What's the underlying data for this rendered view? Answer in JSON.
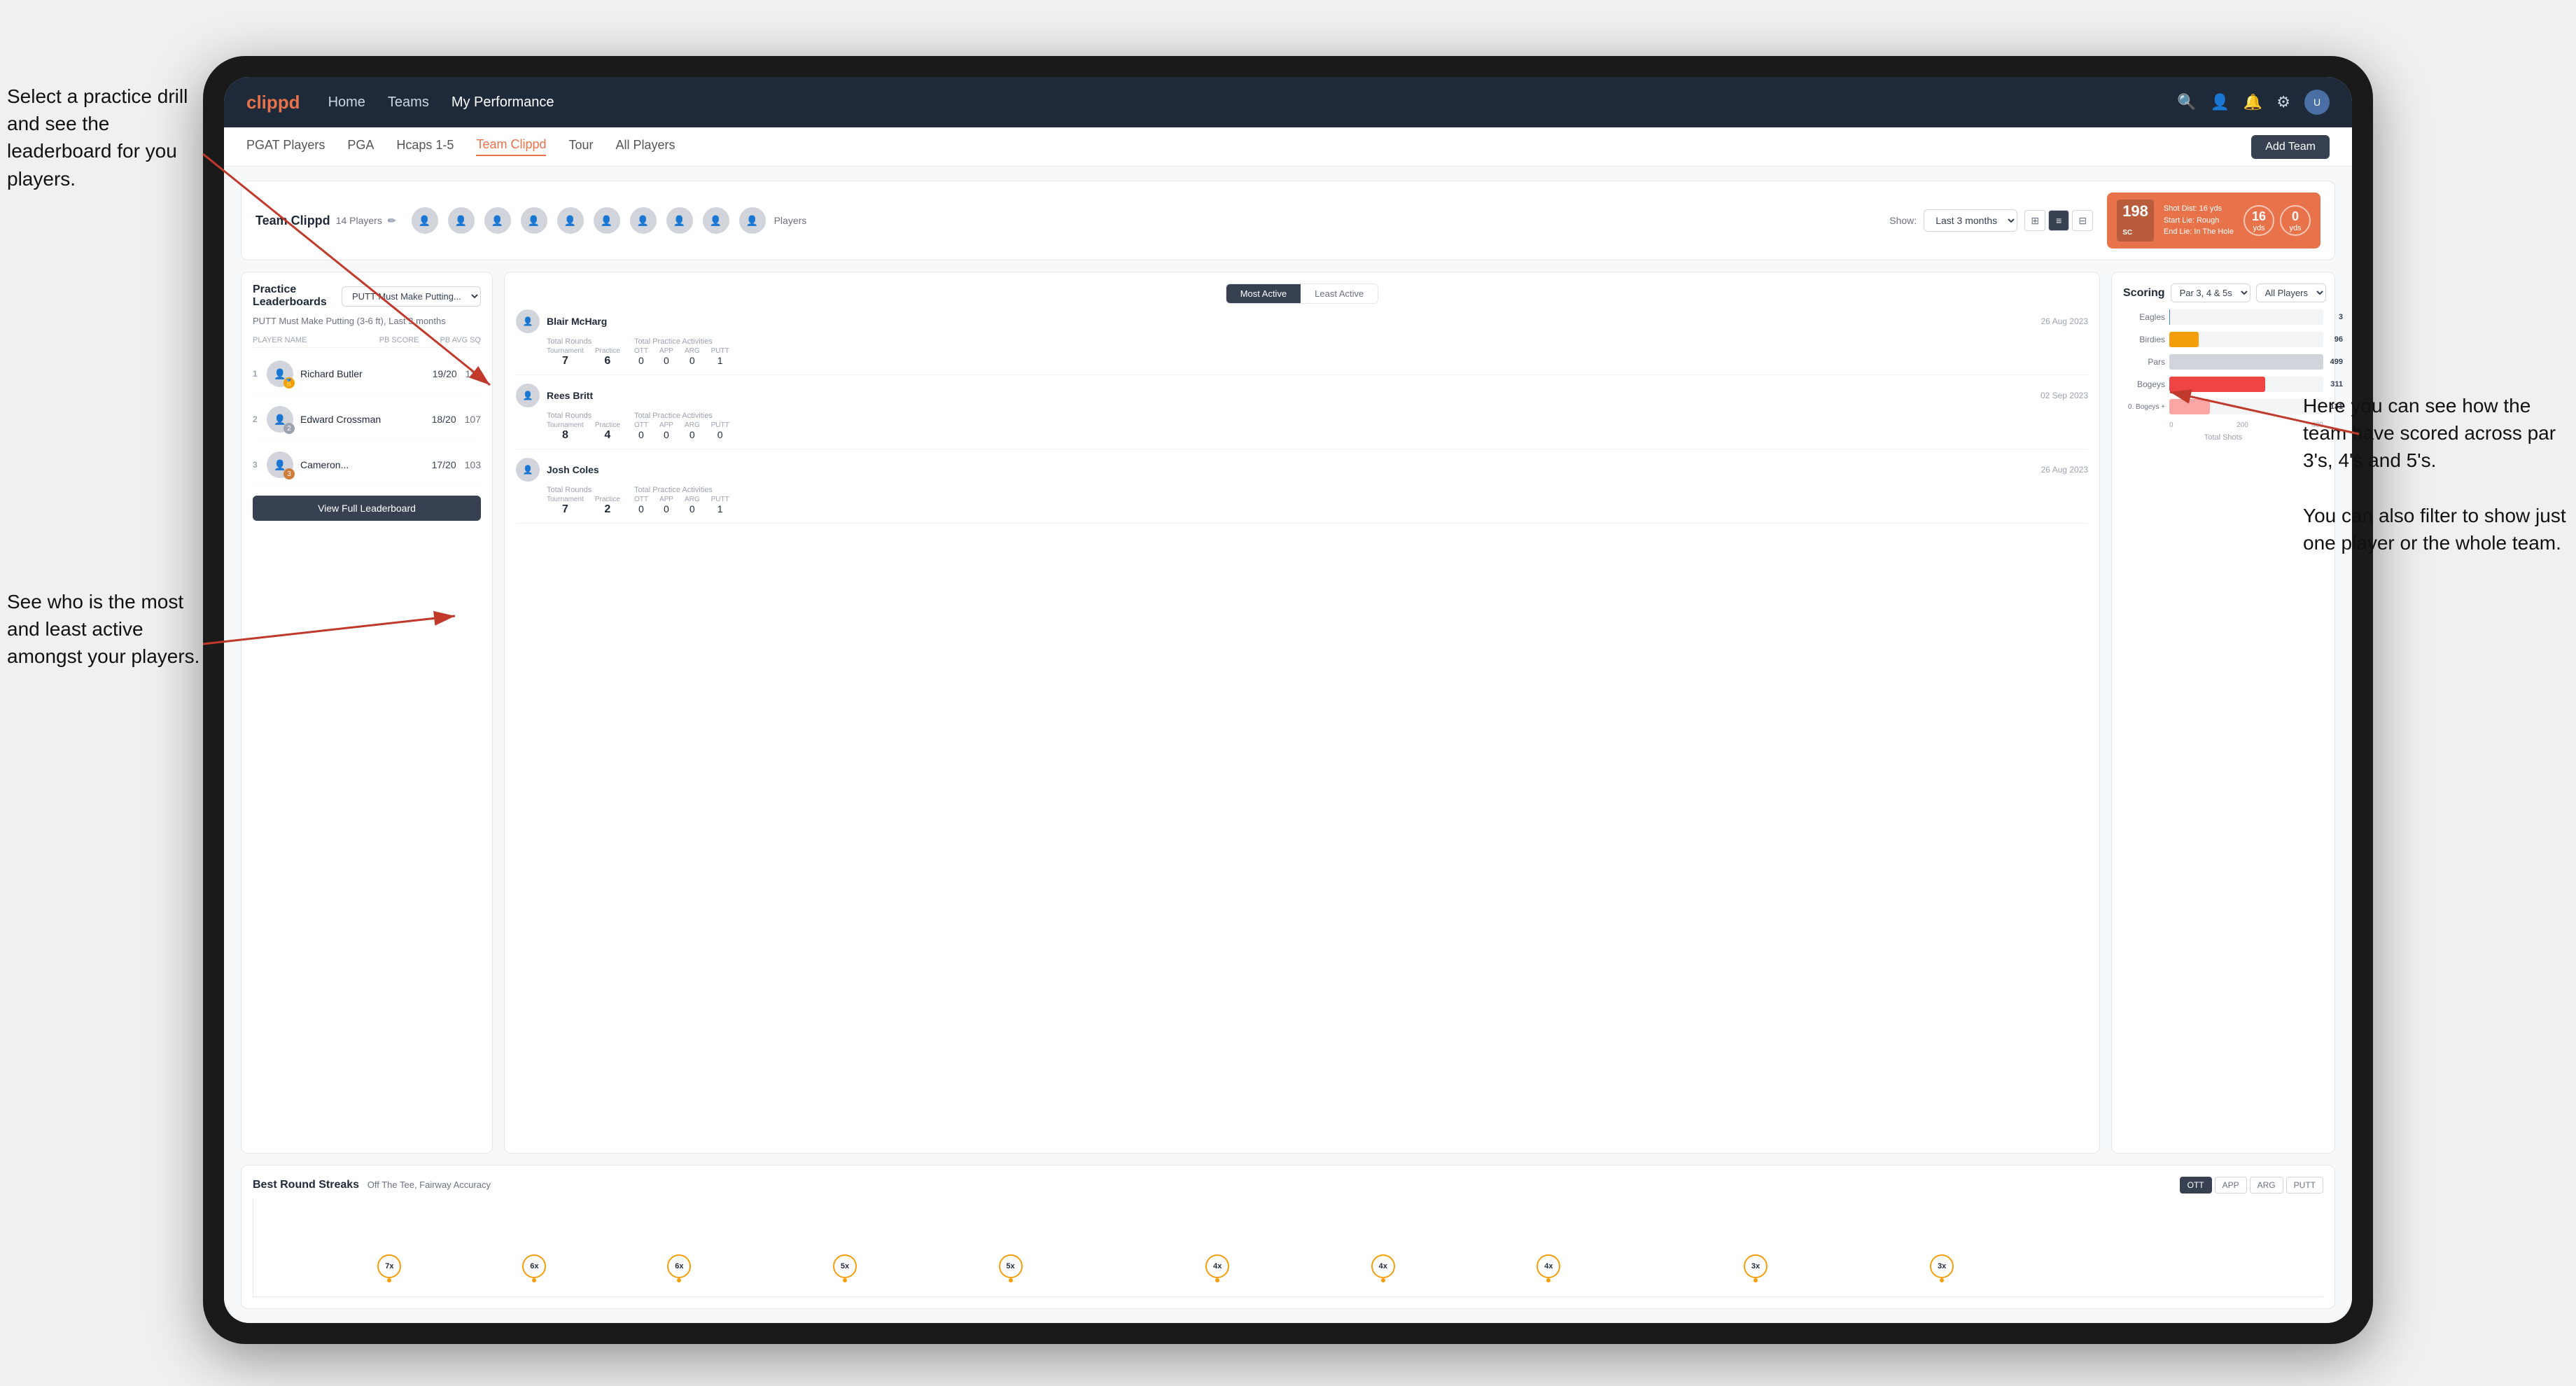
{
  "annotations": {
    "top_left": "Select a practice drill and see the leaderboard for you players.",
    "bottom_left": "See who is the most and least active amongst your players.",
    "top_right": "Here you can see how the team have scored across par 3's, 4's and 5's.\n\nYou can also filter to show just one player or the whole team."
  },
  "navbar": {
    "logo": "clippd",
    "links": [
      "Home",
      "Teams",
      "My Performance"
    ],
    "icons": [
      "search",
      "person",
      "bell",
      "settings",
      "avatar"
    ]
  },
  "subnav": {
    "items": [
      "PGAT Players",
      "PGA",
      "Hcaps 1-5",
      "Team Clippd",
      "Tour",
      "All Players"
    ],
    "active": "Team Clippd",
    "add_btn": "Add Team"
  },
  "team_header": {
    "title": "Team Clippd",
    "count": "14 Players",
    "show_label": "Show:",
    "show_value": "Last 3 months",
    "players_label": "Players"
  },
  "shot_card": {
    "badge": "198",
    "badge_sub": "SC",
    "info_line1": "Shot Dist: 16 yds",
    "info_line2": "Start Lie: Rough",
    "info_line3": "End Lie: In The Hole",
    "circle1_val": "16",
    "circle1_label": "yds",
    "circle2_val": "0",
    "circle2_label": "yds"
  },
  "practice_leaderboard": {
    "title": "Practice Leaderboards",
    "drill_name": "PUTT Must Make Putting...",
    "subtitle": "PUTT Must Make Putting (3-6 ft), Last 3 months",
    "cols": [
      "PLAYER NAME",
      "PB SCORE",
      "PB AVG SQ"
    ],
    "players": [
      {
        "rank": 1,
        "name": "Richard Butler",
        "score": "19/20",
        "avg": "110",
        "medal": "gold"
      },
      {
        "rank": 2,
        "name": "Edward Crossman",
        "score": "18/20",
        "avg": "107",
        "medal": "silver"
      },
      {
        "rank": 3,
        "name": "Cameron...",
        "score": "17/20",
        "avg": "103",
        "medal": "bronze"
      }
    ],
    "view_btn": "View Full Leaderboard"
  },
  "activity": {
    "tabs": [
      "Most Active",
      "Least Active"
    ],
    "active_tab": "Most Active",
    "players": [
      {
        "name": "Blair McHarg",
        "date": "26 Aug 2023",
        "total_rounds_label": "Total Rounds",
        "tournament": "7",
        "practice": "6",
        "practice_activities_label": "Total Practice Activities",
        "ott": "0",
        "app": "0",
        "arg": "0",
        "putt": "1"
      },
      {
        "name": "Rees Britt",
        "date": "02 Sep 2023",
        "total_rounds_label": "Total Rounds",
        "tournament": "8",
        "practice": "4",
        "practice_activities_label": "Total Practice Activities",
        "ott": "0",
        "app": "0",
        "arg": "0",
        "putt": "0"
      },
      {
        "name": "Josh Coles",
        "date": "26 Aug 2023",
        "total_rounds_label": "Total Rounds",
        "tournament": "7",
        "practice": "2",
        "practice_activities_label": "Total Practice Activities",
        "ott": "0",
        "app": "0",
        "arg": "0",
        "putt": "1"
      }
    ]
  },
  "scoring": {
    "title": "Scoring",
    "filter1": "Par 3, 4 & 5s",
    "filter2": "All Players",
    "bars": [
      {
        "label": "Eagles",
        "value": 3,
        "max": 500,
        "type": "eagles"
      },
      {
        "label": "Birdies",
        "value": 96,
        "max": 500,
        "type": "birdies"
      },
      {
        "label": "Pars",
        "value": 499,
        "max": 500,
        "type": "pars"
      },
      {
        "label": "Bogeys",
        "value": 311,
        "max": 500,
        "type": "bogeys"
      },
      {
        "label": "0. Bogeys +",
        "value": 131,
        "max": 500,
        "type": "dbogeys"
      }
    ],
    "x_labels": [
      "0",
      "200",
      "400"
    ],
    "x_title": "Total Shots"
  },
  "best_round_streaks": {
    "title": "Best Round Streaks",
    "subtitle": "Off The Tee, Fairway Accuracy",
    "filters": [
      "OTT",
      "APP",
      "ARG",
      "PUTT"
    ],
    "active_filter": "OTT",
    "bubbles": [
      {
        "count": "7x",
        "x_pct": 8
      },
      {
        "count": "6x",
        "x_pct": 15
      },
      {
        "count": "6x",
        "x_pct": 22
      },
      {
        "count": "5x",
        "x_pct": 30
      },
      {
        "count": "5x",
        "x_pct": 37
      },
      {
        "count": "4x",
        "x_pct": 48
      },
      {
        "count": "4x",
        "x_pct": 55
      },
      {
        "count": "4x",
        "x_pct": 62
      },
      {
        "count": "3x",
        "x_pct": 72
      },
      {
        "count": "3x",
        "x_pct": 80
      }
    ]
  }
}
